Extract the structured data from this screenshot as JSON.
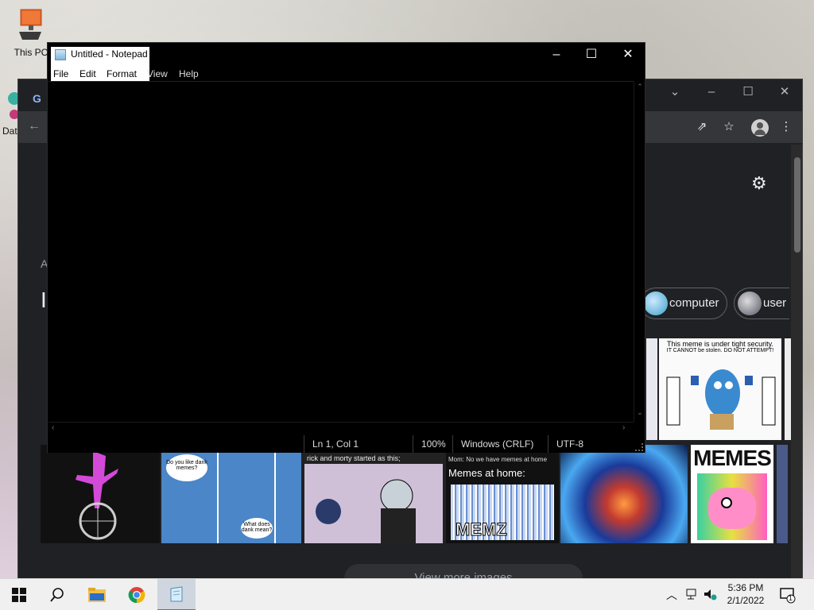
{
  "desktop": {
    "icons": [
      {
        "label": "This PC",
        "icon": "this-pc-icon"
      },
      {
        "label": "Dat",
        "icon": "app-shortcut-icon"
      }
    ]
  },
  "chrome": {
    "chips": [
      {
        "label": "computer"
      },
      {
        "label": "user"
      }
    ],
    "image_captions": [
      "This meme is under tight security.",
      "IT CANNOT be stolen. DO NOT ATTEMPT!",
      "Do you like dank memes?",
      "What does dank mean?",
      "rick and morty started as this;",
      "Mom: No we have memes at home",
      "Memes at home:",
      "MEMZ",
      "MEMES"
    ],
    "view_more_label": "View more images",
    "partial_letters": [
      "A",
      "I"
    ]
  },
  "notepad": {
    "title": "Untitled - Notepad",
    "menu": [
      "File",
      "Edit",
      "Format",
      "View",
      "Help"
    ],
    "status": {
      "position": "Ln 1, Col 1",
      "zoom": "100%",
      "line_ending": "Windows (CRLF)",
      "encoding": "UTF-8"
    }
  },
  "taskbar": {
    "items": [
      "start-icon",
      "search-icon",
      "file-explorer-icon",
      "chrome-icon",
      "notepad-icon"
    ],
    "clock_time": "5:36 PM",
    "clock_date": "2/1/2022",
    "notification_count": "1"
  },
  "colors": {
    "chrome_bg": "#202124",
    "notepad_bg": "#000000",
    "taskbar_bg": "#f0f0f0"
  }
}
